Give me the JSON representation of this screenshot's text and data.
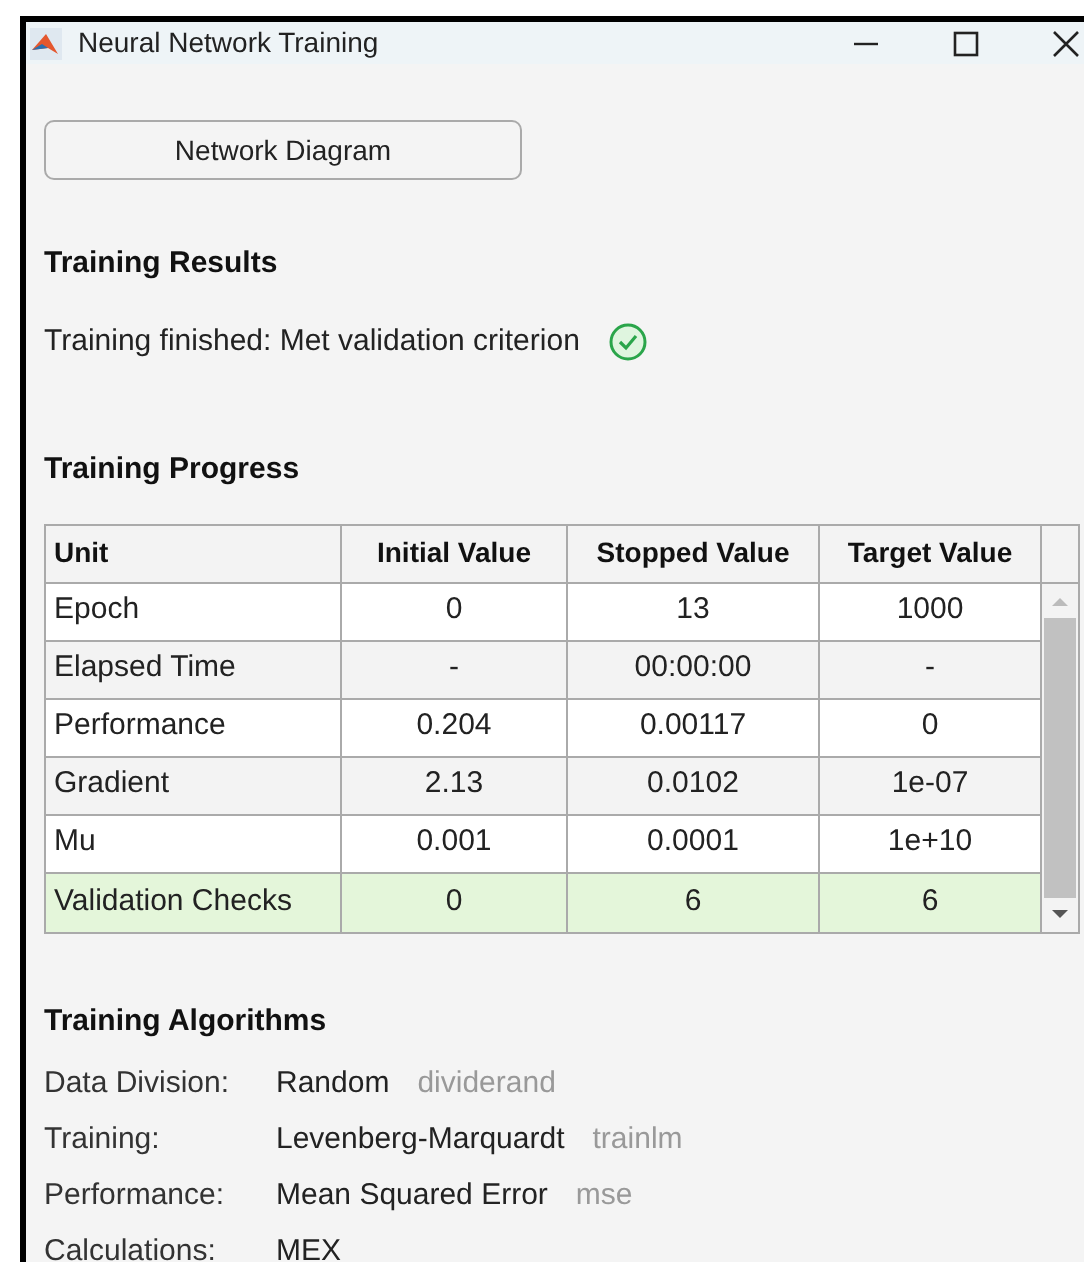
{
  "window": {
    "title": "Neural Network Training"
  },
  "diagram_button": "Network Diagram",
  "results": {
    "heading": "Training Results",
    "status": "Training finished: Met validation criterion",
    "met": true
  },
  "progress": {
    "heading": "Training Progress",
    "columns": [
      "Unit",
      "Initial Value",
      "Stopped Value",
      "Target Value"
    ],
    "rows": [
      {
        "cells": [
          "Epoch",
          "0",
          "13",
          "1000"
        ],
        "highlighted": false
      },
      {
        "cells": [
          "Elapsed Time",
          "-",
          "00:00:00",
          "-"
        ],
        "highlighted": false
      },
      {
        "cells": [
          "Performance",
          "0.204",
          "0.00117",
          "0"
        ],
        "highlighted": false
      },
      {
        "cells": [
          "Gradient",
          "2.13",
          "0.0102",
          "1e-07"
        ],
        "highlighted": false
      },
      {
        "cells": [
          "Mu",
          "0.001",
          "0.0001",
          "1e+10"
        ],
        "highlighted": false
      },
      {
        "cells": [
          "Validation Checks",
          "0",
          "6",
          "6"
        ],
        "highlighted": true
      }
    ]
  },
  "algorithms": {
    "heading": "Training Algorithms",
    "items": [
      {
        "label": "Data Division:",
        "value": "Random",
        "function": "dividerand"
      },
      {
        "label": "Training:",
        "value": "Levenberg-Marquardt",
        "function": "trainlm"
      },
      {
        "label": "Performance:",
        "value": "Mean Squared Error",
        "function": "mse"
      },
      {
        "label": "Calculations:",
        "value": "MEX"
      }
    ]
  }
}
